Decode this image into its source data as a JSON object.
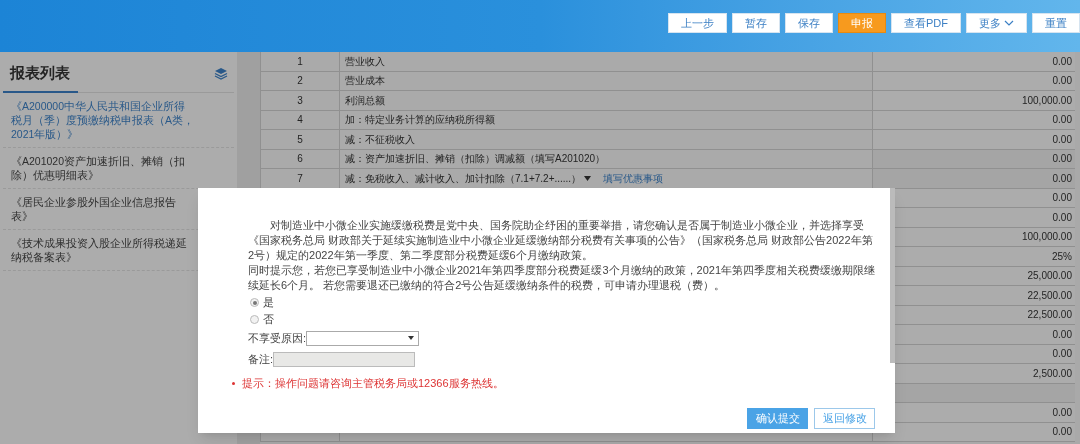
{
  "toolbar": {
    "buttons": [
      {
        "label": "上一步",
        "kind": "normal"
      },
      {
        "label": "暂存",
        "kind": "normal"
      },
      {
        "label": "保存",
        "kind": "normal"
      },
      {
        "label": "申报",
        "kind": "primary"
      },
      {
        "label": "查看PDF",
        "kind": "normal"
      },
      {
        "label": "更多",
        "kind": "dropdown"
      },
      {
        "label": "重置",
        "kind": "normal"
      }
    ]
  },
  "sidebar": {
    "title": "报表列表",
    "items": [
      {
        "label": "《A200000中华人民共和国企业所得税月（季）度预缴纳税申报表（A类，2021年版）》",
        "selected": true
      },
      {
        "label": "《A201020资产加速折旧、摊销（扣除）优惠明细表》",
        "selected": false
      },
      {
        "label": "《居民企业参股外国企业信息报告表》",
        "selected": false
      },
      {
        "label": "《技术成果投资入股企业所得税递延纳税备案表》",
        "selected": false
      }
    ]
  },
  "table": {
    "rows": [
      {
        "number": "1",
        "item": "营业收入",
        "value": "0.00"
      },
      {
        "number": "2",
        "item": "营业成本",
        "value": "0.00"
      },
      {
        "number": "3",
        "item": "利润总额",
        "value": "100,000.00"
      },
      {
        "number": "4",
        "item": "加：特定业务计算的应纳税所得额",
        "value": "0.00"
      },
      {
        "number": "5",
        "item": "减：不征税收入",
        "value": "0.00"
      },
      {
        "number": "6",
        "item": "减：资产加速折旧、摊销（扣除）调减额（填写A201020）",
        "value": "0.00",
        "readonly": true
      },
      {
        "number": "7",
        "item": "减：免税收入、减计收入、加计扣除（7.1+7.2+......）",
        "dropdown": true,
        "link": "填写优惠事项",
        "value": "0.00",
        "readonly": true
      },
      {
        "value": "0.00"
      },
      {
        "value": "0.00"
      },
      {
        "value": "100,000.00"
      },
      {
        "value": "25%"
      },
      {
        "value": "25,000.00"
      },
      {
        "value": "22,500.00"
      },
      {
        "value": "22,500.00"
      },
      {
        "value": "0.00"
      },
      {
        "value": "0.00"
      },
      {
        "value": "2,500.00"
      },
      {
        "value": "",
        "readonly": true
      },
      {
        "value": "0.00"
      },
      {
        "value": "0.00"
      }
    ]
  },
  "dialog": {
    "paragraphs": [
      "对制造业中小微企业实施缓缴税费是党中央、国务院助企纾困的重要举措，请您确认是否属于制造业小微企业，并选择享受《国家税务总局 财政部关于延续实施制造业中小微企业延缓缴纳部分税费有关事项的公告》（国家税务总局 财政部公告2022年第2号）规定的2022年第一季度、第二季度部分税费延缓6个月缴纳政策。",
      "同时提示您，若您已享受制造业中小微企业2021年第四季度部分税费延缓3个月缴纳的政策，2021年第四季度相关税费缓缴期限继续延长6个月。 若您需要退还已缴纳的符合2号公告延缓缴纳条件的税费，可申请办理退税（费）。"
    ],
    "options": [
      {
        "label": "是",
        "selected": true
      },
      {
        "label": "否",
        "selected": false
      }
    ],
    "reason_select": {
      "label": "不享受原因:"
    },
    "note_field": {
      "label": "备注:",
      "disabled": true
    },
    "tip": "提示：操作问题请咨询主管税务局或12366服务热线。",
    "buttons": [
      {
        "label": "确认提交",
        "kind": "primary"
      },
      {
        "label": "返回修改",
        "kind": "secondary"
      }
    ]
  }
}
